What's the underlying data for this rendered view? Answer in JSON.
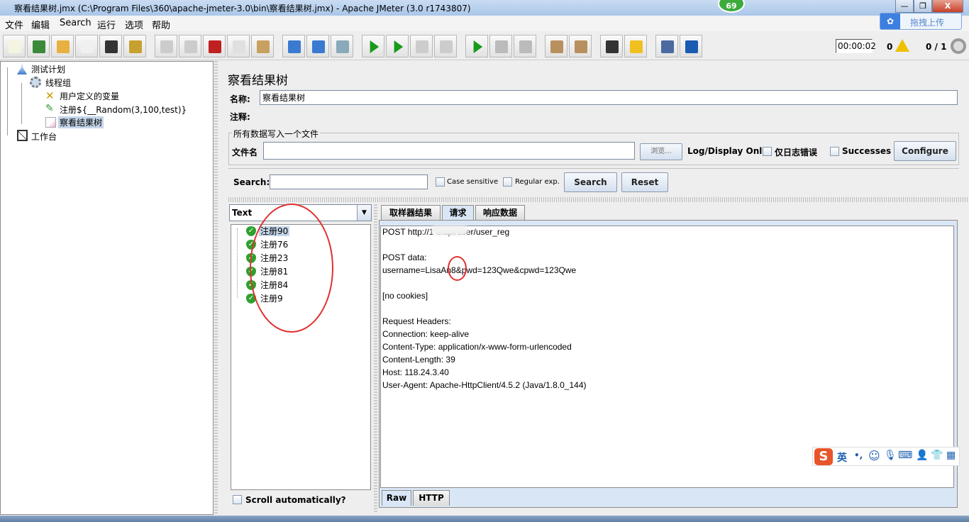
{
  "window": {
    "title": "察看结果树.jmx (C:\\Program Files\\360\\apache-jmeter-3.0\\bin\\察看结果树.jmx) - Apache JMeter (3.0 r1743807)",
    "badge": "69",
    "upload": "拖拽上传",
    "min": "—",
    "max": "❐",
    "close": "X"
  },
  "menu": [
    "文件",
    "编辑",
    "Search",
    "运行",
    "选项",
    "帮助"
  ],
  "toolbar": {
    "icons": [
      "new-icon",
      "templates-icon",
      "open-icon",
      "close-icon",
      "save-icon",
      "save-as-icon",
      "undo-icon",
      "redo-icon",
      "cut-icon",
      "copy-icon",
      "paste-icon",
      "expand-icon",
      "collapse-icon",
      "toggle-icon",
      "start-icon",
      "start-no-pause-icon",
      "stop-icon",
      "shutdown-icon",
      "remote-start-icon",
      "remote-stop-icon",
      "remote-shutdown-icon",
      "clear-icon",
      "clear-all-icon",
      "search-icon",
      "reset-search-icon",
      "function-helper-icon",
      "help-icon"
    ],
    "timer": "00:00:02",
    "warnings": "0",
    "threads": "0 / 1"
  },
  "tree": [
    {
      "label": "测试计划"
    },
    {
      "label": "线程组"
    },
    {
      "label": "用户定义的变量"
    },
    {
      "label": "注册${__Random(3,100,test)}"
    },
    {
      "label": "察看结果树"
    },
    {
      "label": "工作台"
    }
  ],
  "main": {
    "title": "察看结果树",
    "name_label": "名称:",
    "name_value": "察看结果树",
    "comment_label": "注释:",
    "file_group": "所有数据写入一个文件",
    "file_label": "文件名",
    "file_value": "",
    "browse": "浏览...",
    "log_display": "Log/Display Only:",
    "errors_only": "仅日志错误",
    "successes": "Successes",
    "configure": "Configure",
    "search_label": "Search:",
    "search_value": "",
    "case_sensitive": "Case sensitive",
    "regular_exp": "Regular exp.",
    "search_btn": "Search",
    "reset_btn": "Reset"
  },
  "results": {
    "renderer": "Text",
    "items": [
      "注册90",
      "注册76",
      "注册23",
      "注册81",
      "注册84",
      "注册9"
    ],
    "scroll_auto": "Scroll automatically?"
  },
  "tabs": [
    "取样器结果",
    "请求",
    "响应数据"
  ],
  "active_tab": "请求",
  "request": {
    "lines": [
      "POST http://1          0/api/user/user_reg",
      "",
      "POST data:",
      "username=LisaAn8&pwd=123Qwe&cpwd=123Qwe",
      "",
      "[no cookies]",
      "",
      "Request Headers:",
      "Connection: keep-alive",
      "Content-Type: application/x-www-form-urlencoded",
      "Content-Length: 39",
      "Host: 118.24.3.40",
      "User-Agent: Apache-HttpClient/4.5.2 (Java/1.8.0_144)"
    ]
  },
  "bottom_tabs": [
    "Raw",
    "HTTP"
  ],
  "ime": {
    "lang": "英",
    "punct": "•,"
  },
  "colors": {
    "annotation": "#e03030",
    "selection": "#c5d6ea",
    "success": "#2da12d"
  }
}
